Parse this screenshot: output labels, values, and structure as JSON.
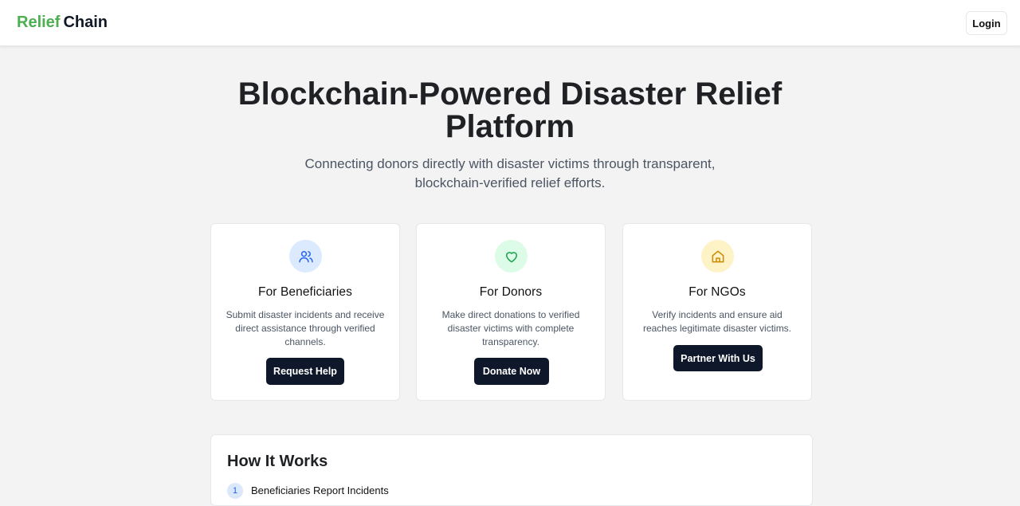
{
  "header": {
    "brand_part1": "Relief",
    "brand_part2": "Chain",
    "login_label": "Login"
  },
  "hero": {
    "title_line1": "Blockchain-Powered Disaster Relief",
    "title_line2": "Platform",
    "subtitle_line1": "Connecting donors directly with disaster victims through transparent,",
    "subtitle_line2": "blockchain-verified relief efforts."
  },
  "cards": [
    {
      "icon": "users-icon",
      "title": "For Beneficiaries",
      "description": "Submit disaster incidents and receive direct assistance through verified channels.",
      "button": "Request Help",
      "icon_bg": "#dbeafe",
      "icon_color": "#2563eb"
    },
    {
      "icon": "heart-icon",
      "title": "For Donors",
      "description": "Make direct donations to verified disaster victims with complete transparency.",
      "button": "Donate Now",
      "icon_bg": "#dcfce7",
      "icon_color": "#16a34a"
    },
    {
      "icon": "home-icon",
      "title": "For NGOs",
      "description": "Verify incidents and ensure aid reaches legitimate disaster victims.",
      "button": "Partner With Us",
      "icon_bg": "#fef3c7",
      "icon_color": "#ca8a04"
    }
  ],
  "how_it_works": {
    "title": "How It Works",
    "steps": [
      {
        "number": "1",
        "label": "Beneficiaries Report Incidents"
      }
    ]
  },
  "colors": {
    "brand_green": "#4caf50",
    "dark_button": "#0f172a",
    "background": "#f3f3f3"
  }
}
